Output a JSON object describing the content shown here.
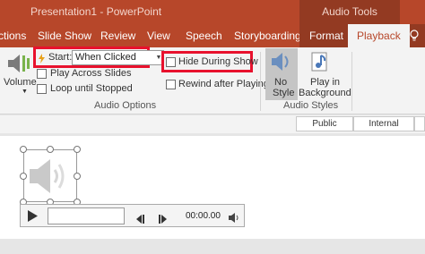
{
  "titlebar": {
    "title": "Presentation1  -  PowerPoint",
    "context_tab": "Audio Tools"
  },
  "tabs": [
    {
      "label": "ctions"
    },
    {
      "label": "Slide Show"
    },
    {
      "label": "Review"
    },
    {
      "label": "View"
    },
    {
      "label": "Speech"
    },
    {
      "label": "Storyboarding"
    },
    {
      "label": "Format"
    },
    {
      "label": "Playback"
    }
  ],
  "ribbon": {
    "volume_label": "Volume",
    "start_label": "Start:",
    "start_value": "When Clicked",
    "play_across_slides": "Play Across Slides",
    "loop_until_stopped": "Loop until Stopped",
    "hide_during_show": "Hide During Show",
    "rewind_after_playing": "Rewind after Playing",
    "audio_options_group": "Audio Options",
    "no_style_line1": "No",
    "no_style_line2": "Style",
    "play_in_bg_line1": "Play in",
    "play_in_bg_line2": "Background",
    "audio_styles_group": "Audio Styles"
  },
  "sensitivity": {
    "public": "Public",
    "internal": "Internal"
  },
  "player": {
    "time": "00:00.00"
  },
  "colors": {
    "ribbon_red": "#b7472a",
    "context_red": "#933a22",
    "highlight_red": "#e8112d"
  }
}
